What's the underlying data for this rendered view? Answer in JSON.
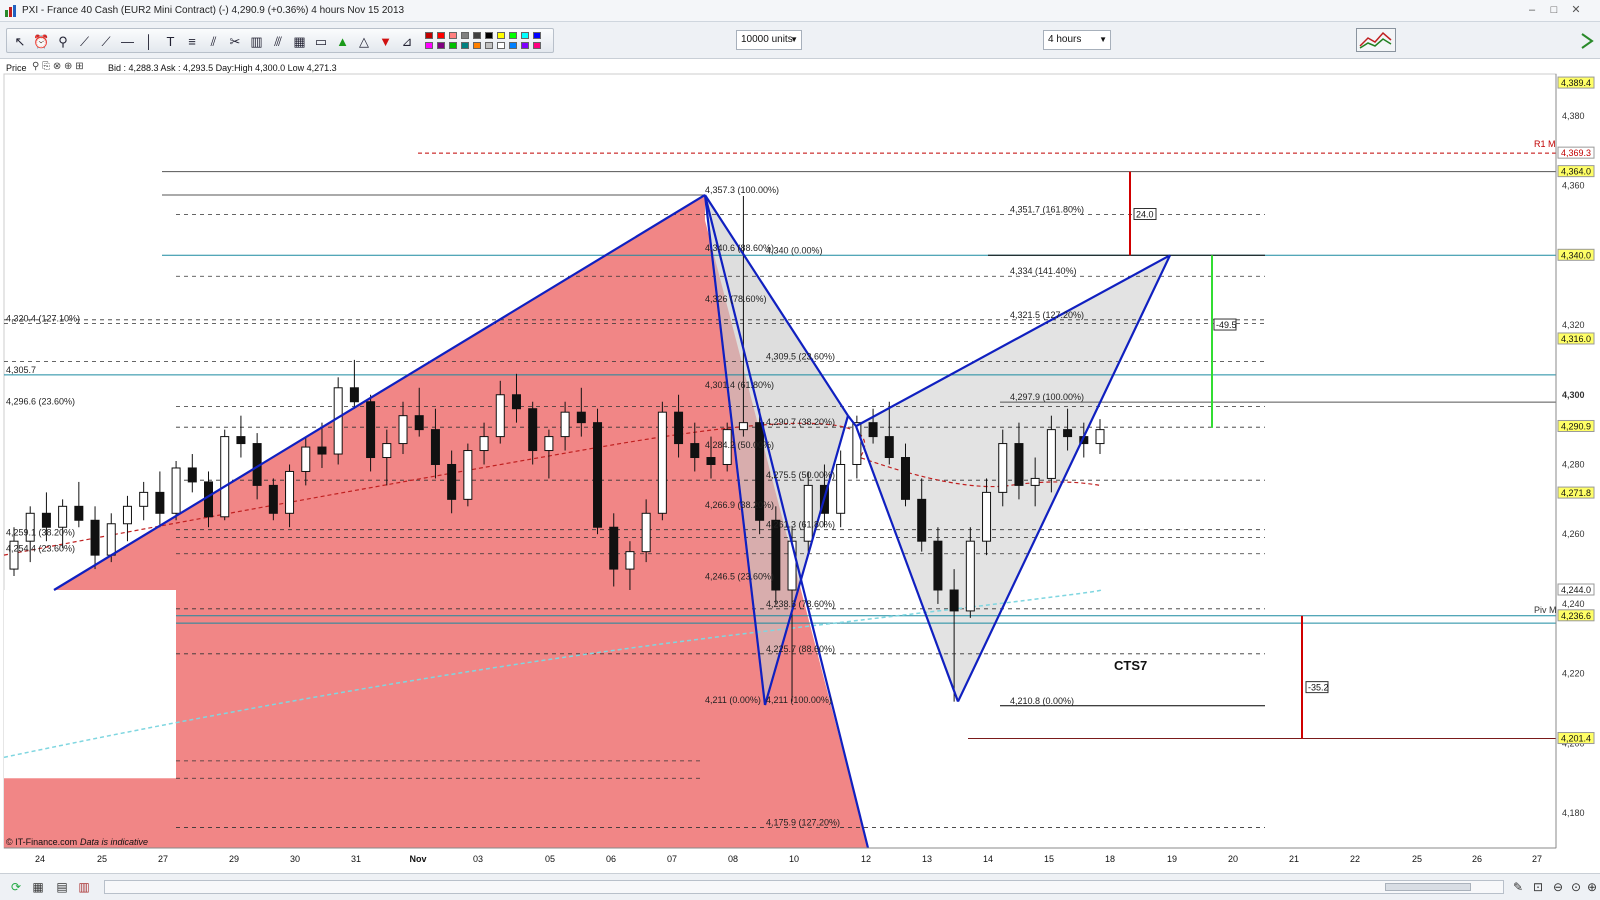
{
  "window": {
    "title": "PXI - France 40 Cash (EUR2 Mini Contract) (-)     4,290.9 (+0.36%)     4 hours   Nov 15 2013",
    "minimize": "–",
    "maximize": "□",
    "close": "✕"
  },
  "toolbar": {
    "units_select": "10000 units",
    "interval_select": "4 hours",
    "tool_icons": [
      "pointer-icon",
      "alarm-icon",
      "zoom-icon",
      "trendline-icon",
      "ray-icon",
      "horizontal-line-icon",
      "vertical-line-icon",
      "text-icon",
      "fibonacci-icon",
      "fan-icon",
      "tools-icon",
      "trash-icon",
      "channel-icon",
      "grid-icon",
      "rectangle-icon",
      "up-arrow-icon",
      "triangle-icon",
      "down-arrow-icon",
      "ruler-icon"
    ],
    "colors": [
      "#c00000",
      "#ff0000",
      "#ff8080",
      "#808080",
      "#404040",
      "#000000",
      "#ffff00",
      "#00ff00",
      "#00ffff",
      "#0000ff",
      "#ff00ff",
      "#800080",
      "#00c000",
      "#008080",
      "#ff8000",
      "#c0c0c0",
      "#ffffff",
      "#0080ff",
      "#8000ff",
      "#ff0080"
    ]
  },
  "infobar": {
    "price_label": "Price",
    "quote": "Bid : 4,288.3  Ask : 4,293.5  Day:High 4,300.0  Low 4,271.3"
  },
  "chart_data": {
    "type": "candlestick",
    "instrument": "France 40 Cash (EUR2 Mini Contract)",
    "interval": "4 hours",
    "ylim": [
      4170,
      4392
    ],
    "y_ticks": [
      4180,
      4200,
      4220,
      4240,
      4260,
      4280,
      4300,
      4320,
      4340,
      4360,
      4380
    ],
    "x_ticks": [
      "24",
      "25",
      "27",
      "29",
      "30",
      "31",
      "Nov",
      "03",
      "05",
      "06",
      "07",
      "08",
      "10",
      "12",
      "13",
      "14",
      "15",
      "18",
      "19",
      "20",
      "21",
      "22",
      "25",
      "26",
      "27"
    ],
    "price_boxes": [
      {
        "value": "4,389.4",
        "color": "#ffff66"
      },
      {
        "value": "4,369.3",
        "color": "#ffffff"
      },
      {
        "value": "4,364.0",
        "color": "#ffff66"
      },
      {
        "value": "4,340.0",
        "color": "#ffff66"
      },
      {
        "value": "4,316.0",
        "color": "#ffff66"
      },
      {
        "value": "4,290.9",
        "color": "#ffff66"
      },
      {
        "value": "4,271.8",
        "color": "#ffff66"
      },
      {
        "value": "4,244.0",
        "color": "#ffffff"
      },
      {
        "value": "4,236.6",
        "color": "#ffff66"
      },
      {
        "value": "4,201.4",
        "color": "#ffff66"
      }
    ],
    "right_labels": [
      "R1 M",
      "Piv M"
    ],
    "fib_labels": [
      "4,357.3 (100.00%)",
      "4,340.6 (88.60%)",
      "4,340 (0.00%)",
      "4,326 (78.60%)",
      "4,309.5 (23.60%)",
      "4,301.4 (61.80%)",
      "4,290.7 (38.20%)",
      "4,284.2 (50.00%)",
      "4,275.5 (50.00%)",
      "4,266.9 (38.20%)",
      "4,261.3 (61.80%)",
      "4,246.5 (23.60%)",
      "4,238.6 (78.60%)",
      "4,225.7 (88.60%)",
      "4,211 (0.00%)",
      "4,211 (100.00%)",
      "4,175.9 (127.20%)",
      "4,351.7 (161.80%)",
      "4,334 (141.40%)",
      "4,321.5 (127.20%)",
      "4,297.9 (100.00%)",
      "4,210.8 (0.00%)",
      "4,320.4 (127.10%)",
      "4,305.7",
      "4,296.6 (23.60%)",
      "4,259.1 (38.20%)",
      "4,254.4 (23.60%)"
    ],
    "measure_labels": [
      "24.0",
      "-49.5",
      "-35.2"
    ],
    "pattern_label": "CTS7",
    "footer_source": "© IT-Finance.com",
    "footer_note": "Data is indicative",
    "candles": [
      [
        4250,
        4262,
        4248,
        4258
      ],
      [
        4258,
        4268,
        4252,
        4266
      ],
      [
        4266,
        4272,
        4258,
        4262
      ],
      [
        4262,
        4270,
        4256,
        4268
      ],
      [
        4268,
        4275,
        4262,
        4264
      ],
      [
        4264,
        4268,
        4250,
        4254
      ],
      [
        4254,
        4266,
        4252,
        4263
      ],
      [
        4263,
        4271,
        4258,
        4268
      ],
      [
        4268,
        4275,
        4264,
        4272
      ],
      [
        4272,
        4278,
        4262,
        4266
      ],
      [
        4266,
        4281,
        4264,
        4279
      ],
      [
        4279,
        4283,
        4272,
        4275
      ],
      [
        4275,
        4278,
        4262,
        4265
      ],
      [
        4265,
        4290,
        4264,
        4288
      ],
      [
        4288,
        4294,
        4282,
        4286
      ],
      [
        4286,
        4289,
        4270,
        4274
      ],
      [
        4274,
        4276,
        4264,
        4266
      ],
      [
        4266,
        4280,
        4262,
        4278
      ],
      [
        4278,
        4288,
        4274,
        4285
      ],
      [
        4285,
        4292,
        4279,
        4283
      ],
      [
        4283,
        4305,
        4280,
        4302
      ],
      [
        4302,
        4310,
        4296,
        4298
      ],
      [
        4298,
        4300,
        4278,
        4282
      ],
      [
        4282,
        4290,
        4274,
        4286
      ],
      [
        4286,
        4298,
        4283,
        4294
      ],
      [
        4294,
        4302,
        4288,
        4290
      ],
      [
        4290,
        4296,
        4276,
        4280
      ],
      [
        4280,
        4284,
        4266,
        4270
      ],
      [
        4270,
        4286,
        4268,
        4284
      ],
      [
        4284,
        4292,
        4280,
        4288
      ],
      [
        4288,
        4304,
        4286,
        4300
      ],
      [
        4300,
        4306,
        4292,
        4296
      ],
      [
        4296,
        4298,
        4280,
        4284
      ],
      [
        4284,
        4290,
        4276,
        4288
      ],
      [
        4288,
        4298,
        4284,
        4295
      ],
      [
        4295,
        4302,
        4288,
        4292
      ],
      [
        4292,
        4296,
        4260,
        4262
      ],
      [
        4262,
        4266,
        4245,
        4250
      ],
      [
        4250,
        4258,
        4244,
        4255
      ],
      [
        4255,
        4270,
        4252,
        4266
      ],
      [
        4266,
        4298,
        4264,
        4295
      ],
      [
        4295,
        4300,
        4282,
        4286
      ],
      [
        4286,
        4292,
        4278,
        4282
      ],
      [
        4282,
        4288,
        4276,
        4280
      ],
      [
        4280,
        4292,
        4278,
        4290
      ],
      [
        4290,
        4357,
        4288,
        4292
      ],
      [
        4292,
        4296,
        4260,
        4264
      ],
      [
        4264,
        4268,
        4240,
        4244
      ],
      [
        4244,
        4262,
        4212,
        4258
      ],
      [
        4258,
        4278,
        4255,
        4274
      ],
      [
        4274,
        4280,
        4262,
        4266
      ],
      [
        4266,
        4284,
        4262,
        4280
      ],
      [
        4280,
        4294,
        4276,
        4292
      ],
      [
        4292,
        4296,
        4286,
        4288
      ],
      [
        4288,
        4298,
        4280,
        4282
      ],
      [
        4282,
        4286,
        4268,
        4270
      ],
      [
        4270,
        4276,
        4255,
        4258
      ],
      [
        4258,
        4262,
        4240,
        4244
      ],
      [
        4244,
        4250,
        4212,
        4238
      ],
      [
        4238,
        4262,
        4236,
        4258
      ],
      [
        4258,
        4276,
        4254,
        4272
      ],
      [
        4272,
        4290,
        4268,
        4286
      ],
      [
        4286,
        4292,
        4270,
        4274
      ],
      [
        4274,
        4282,
        4268,
        4276
      ],
      [
        4276,
        4294,
        4272,
        4290
      ],
      [
        4290,
        4296,
        4284,
        4288
      ],
      [
        4288,
        4292,
        4282,
        4286
      ],
      [
        4286,
        4293,
        4283,
        4290
      ]
    ]
  },
  "statusbar": {
    "left_icons": [
      "chart-refresh-icon",
      "calculator-icon",
      "layout-icon",
      "bars-icon"
    ],
    "right_icons": [
      "pen-icon",
      "fit-icon",
      "zoom-out-icon",
      "zoom-fit-icon",
      "zoom-in-icon"
    ]
  }
}
